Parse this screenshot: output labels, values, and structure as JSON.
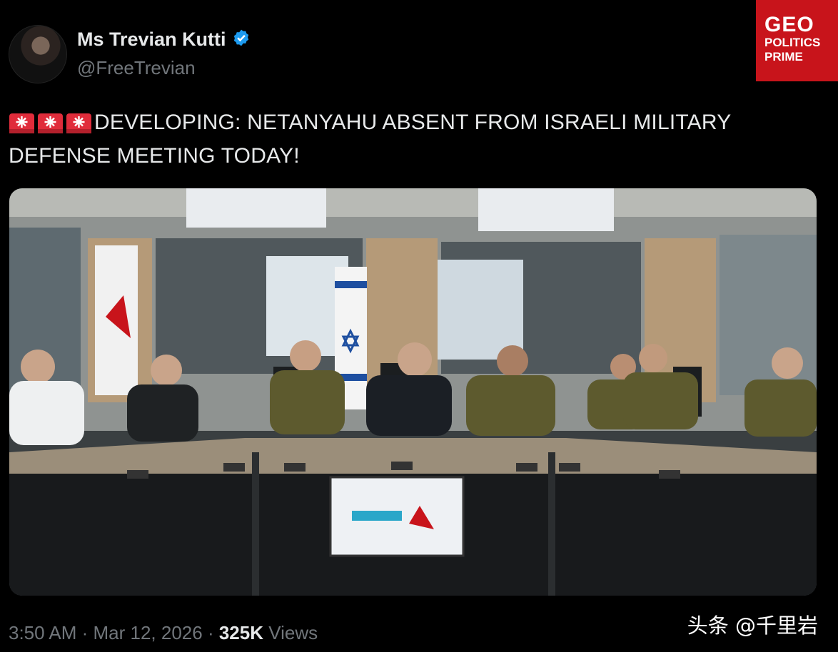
{
  "author": {
    "name": "Ms Trevian Kutti",
    "handle": "@FreeTrevian",
    "verified": true
  },
  "badge": {
    "line1": "GEO",
    "line2": "POLITICS",
    "line3": "PRIME",
    "color": "#c8141b"
  },
  "tweet": {
    "prefix_icons": [
      "siren-icon",
      "siren-icon",
      "siren-icon"
    ],
    "text": "DEVELOPING: NETANYAHU ABSENT FROM ISRAELI MILITARY DEFENSE MEETING TODAY!"
  },
  "meta": {
    "time": "3:50 AM",
    "sep1": " · ",
    "date": "Mar 12, 2026",
    "sep2": " · ",
    "views_count": "325K",
    "views_label": " Views"
  },
  "watermark": "头条 @千里岩",
  "colors": {
    "background": "#000000",
    "text": "#e7e9ea",
    "secondary": "#71767b",
    "verified": "#1d9bf0"
  }
}
